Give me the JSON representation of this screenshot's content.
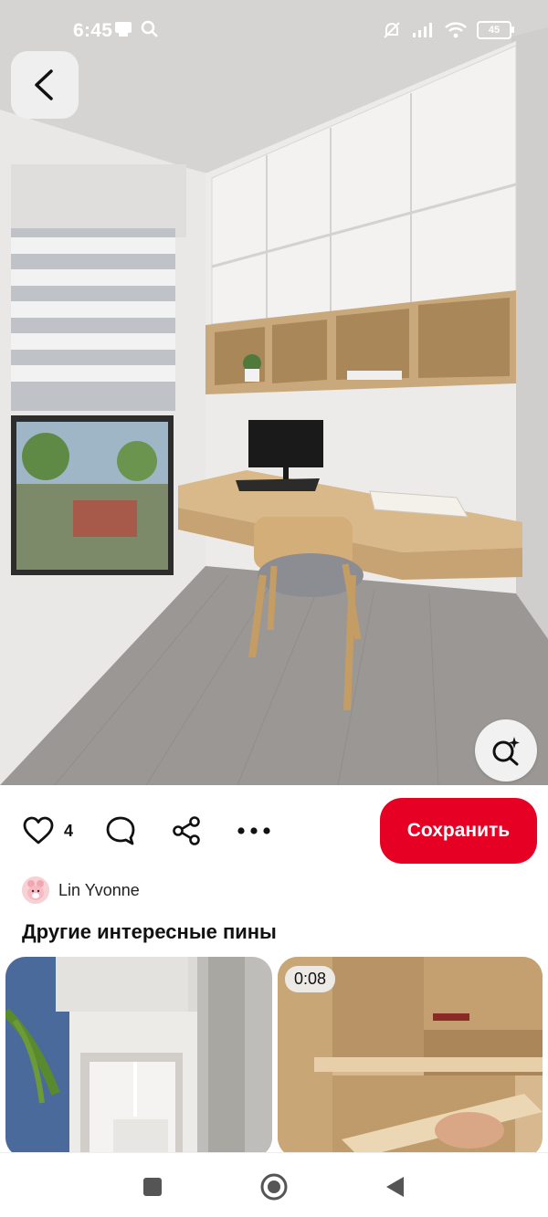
{
  "status_bar": {
    "time": "6:45",
    "battery": "45",
    "icons": [
      "notification-icon",
      "search-icon",
      "mute-icon",
      "signal-icon",
      "wifi-icon",
      "battery-icon"
    ]
  },
  "pin": {
    "image": "home-office-nook-photo",
    "like_count": "4",
    "save_label": "Сохранить",
    "author_name": "Lin Yvonne"
  },
  "related": {
    "title": "Другие интересные пины",
    "video_duration": "0:08"
  },
  "colors": {
    "accent": "#e60023",
    "text": "#111111",
    "button_bg": "#efefef"
  }
}
